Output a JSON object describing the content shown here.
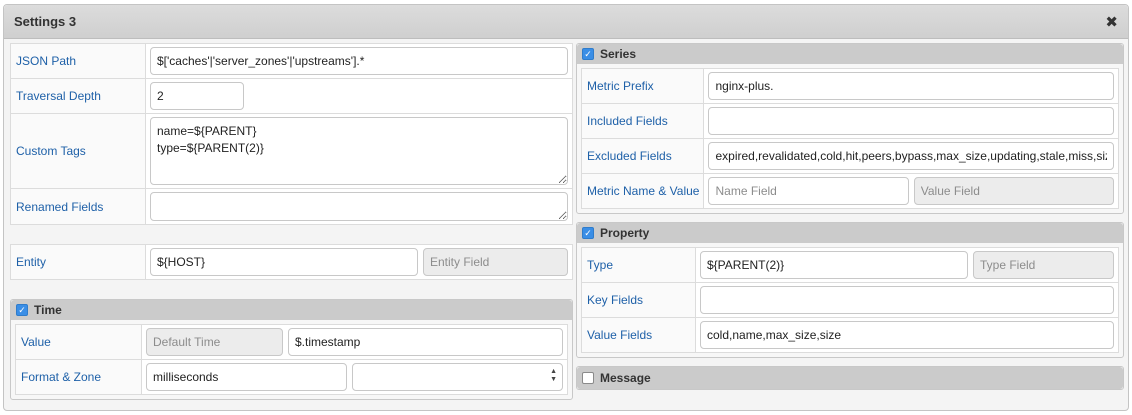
{
  "dialog": {
    "title": "Settings 3",
    "close_glyph": "✖"
  },
  "left": {
    "json_path": {
      "label": "JSON Path",
      "value": "$['caches'|'server_zones'|'upstreams'].*"
    },
    "traversal_depth": {
      "label": "Traversal Depth",
      "value": "2"
    },
    "custom_tags": {
      "label": "Custom Tags",
      "value": "name=${PARENT}\ntype=${PARENT(2)}"
    },
    "renamed_fields": {
      "label": "Renamed Fields",
      "value": ""
    },
    "entity": {
      "label": "Entity",
      "value": "${HOST}",
      "field_placeholder": "Entity Field"
    }
  },
  "time": {
    "title": "Time",
    "checked": true,
    "value_row": {
      "label": "Value",
      "default_placeholder": "Default Time",
      "value": "$.timestamp"
    },
    "format_row": {
      "label": "Format & Zone",
      "format_value": "milliseconds",
      "zone_value": ""
    }
  },
  "series": {
    "title": "Series",
    "checked": true,
    "metric_prefix": {
      "label": "Metric Prefix",
      "value": "nginx-plus."
    },
    "included_fields": {
      "label": "Included Fields",
      "value": ""
    },
    "excluded_fields": {
      "label": "Excluded Fields",
      "value": "expired,revalidated,cold,hit,peers,bypass,max_size,updating,stale,miss,size"
    },
    "metric_name_value": {
      "label": "Metric Name & Value",
      "name_placeholder": "Name Field",
      "value_placeholder": "Value Field"
    }
  },
  "property": {
    "title": "Property",
    "checked": true,
    "type": {
      "label": "Type",
      "value": "${PARENT(2)}",
      "type_placeholder": "Type Field"
    },
    "key_fields": {
      "label": "Key Fields",
      "value": ""
    },
    "value_fields": {
      "label": "Value Fields",
      "value": "cold,name,max_size,size"
    }
  },
  "message": {
    "title": "Message",
    "checked": false
  },
  "colors": {
    "label_blue": "#1e60a8",
    "checkbox_blue": "#3a8ee6",
    "panel_header": "#cbcbcb"
  },
  "icons": {
    "close": "close-icon",
    "checkbox": "checkbox-icon",
    "select_arrows": "select-arrows-icon"
  }
}
